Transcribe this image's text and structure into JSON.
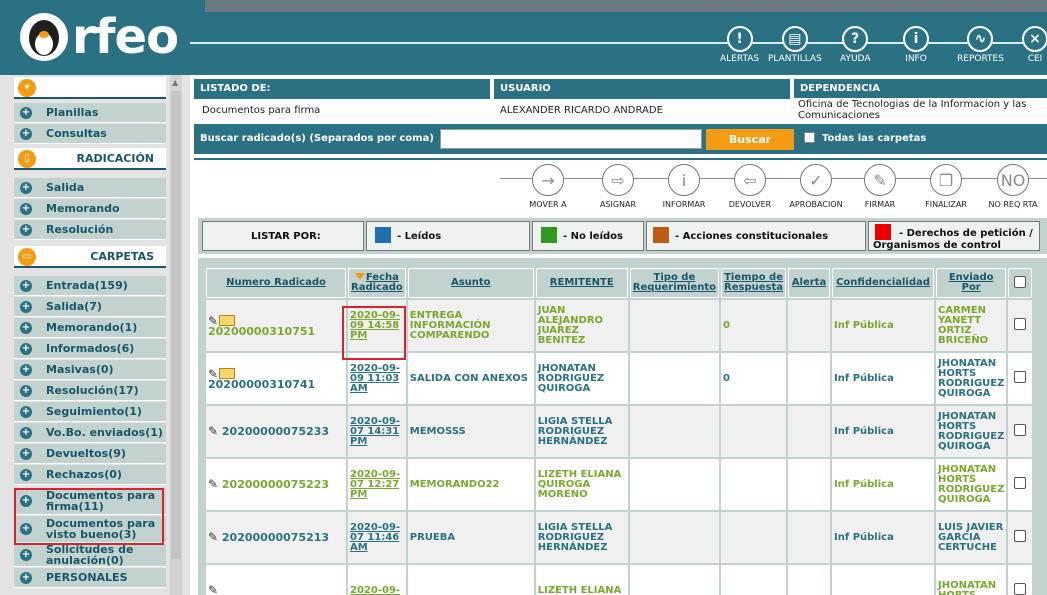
{
  "app": {
    "logo_text": "rfeo",
    "nav": [
      {
        "label": "ALERTAS",
        "icon": "alert-icon",
        "glyph": "!"
      },
      {
        "label": "PLANTILLAS",
        "icon": "template-icon",
        "glyph": "▤"
      },
      {
        "label": "AYUDA",
        "icon": "help-icon",
        "glyph": "?"
      },
      {
        "label": "INFO",
        "icon": "info-icon",
        "glyph": "i"
      },
      {
        "label": "REPORTES",
        "icon": "reports-icon",
        "glyph": "∿"
      },
      {
        "label": "CEI",
        "icon": "close-session-icon",
        "glyph": "×"
      }
    ]
  },
  "sidebar": {
    "top_items": [
      "Planillas",
      "Consultas"
    ],
    "radicacion_title": "RADICACIÓN",
    "radicacion_items": [
      "Salida",
      "Memorando",
      "Resolución"
    ],
    "carpetas_title": "CARPETAS",
    "carpetas_items": [
      "Entrada(159)",
      "Salida(7)",
      "Memorando(1)",
      "Informados(6)",
      "Masivas(0)",
      "Resolución(17)",
      "Seguimiento(1)",
      "Vo.Bo. enviados(1)",
      "Devueltos(9)",
      "Rechazos(0)",
      "Documentos para firma(11)",
      "Documentos para visto bueno(3)",
      "Solicitudes de anulación(0)",
      "PERSONALES"
    ]
  },
  "header": {
    "listado_label": "LISTADO DE:",
    "listado_value": "Documentos para firma",
    "usuario_label": "USUARIO",
    "usuario_value": "ALEXANDER RICARDO ANDRADE",
    "dependencia_label": "DEPENDENCIA",
    "dependencia_value": "Oficina de Tecnologias de la Informacion y las Comunicaciones"
  },
  "search": {
    "label": "Buscar radicado(s) (Separados por coma)",
    "value": "",
    "button": "Buscar",
    "all_folders_label": "Todas las carpetas"
  },
  "toolbar": [
    {
      "label": "MOVER A",
      "icon": "move-icon",
      "glyph": "→"
    },
    {
      "label": "ASIGNAR",
      "icon": "assign-icon",
      "glyph": "⇨"
    },
    {
      "label": "INFORMAR",
      "icon": "inform-icon",
      "glyph": "i"
    },
    {
      "label": "DEVOLVER",
      "icon": "return-icon",
      "glyph": "⇦"
    },
    {
      "label": "APROBACION",
      "icon": "approve-icon",
      "glyph": "✓"
    },
    {
      "label": "FIRMAR",
      "icon": "sign-icon",
      "glyph": "✎"
    },
    {
      "label": "FINALIZAR",
      "icon": "finish-icon",
      "glyph": "❐"
    },
    {
      "label": "NO REQ RTA",
      "icon": "no-response-icon",
      "glyph": "NO"
    }
  ],
  "legend": {
    "title": "LISTAR POR:",
    "items": [
      {
        "label": "- Leídos",
        "color": "#1d6fb0"
      },
      {
        "label": "- No leídos",
        "color": "#2e9a1f"
      },
      {
        "label": "- Acciones constitucionales",
        "color": "#c05c12"
      },
      {
        "label": "- Derechos de petición / Organismos de control",
        "color": "#ee0000"
      }
    ]
  },
  "table": {
    "columns": [
      "Numero Radicado",
      "Fecha Radicado",
      "Asunto",
      "REMITENTE",
      "Tipo de Requerimiento",
      "Tiempo de Respuesta",
      "Alerta",
      "Confidencialidad",
      "Enviado Por"
    ],
    "rows": [
      {
        "numero": "20200000310751",
        "fecha": "2020-09-09 14:58 PM",
        "asunto": "ENTREGA INFORMACIÓN COMPARENDO",
        "remitente": "JUAN ALEJANDRO JUAREZ BENITEZ",
        "tipo": "",
        "tiempo": "0",
        "alerta": "",
        "conf": "Inf Pública",
        "enviado": "CARMEN YANETT ORTIZ BRICEÑO"
      },
      {
        "numero": "20200000310741",
        "fecha": "2020-09-09 11:03 AM",
        "asunto": "SALIDA CON ANEXOS",
        "remitente": "JHONATAN RODRIGUEZ QUIROGA",
        "tipo": "",
        "tiempo": "0",
        "alerta": "",
        "conf": "Inf Pública",
        "enviado": "JHONATAN HORTS RODRIGUEZ QUIROGA"
      },
      {
        "numero": "20200000075233",
        "fecha": "2020-09-07 14:31 PM",
        "asunto": "MEMOSSS",
        "remitente": "LIGIA STELLA RODRIGUEZ HERNÁNDEZ",
        "tipo": "",
        "tiempo": "",
        "alerta": "",
        "conf": "Inf Pública",
        "enviado": "JHONATAN HORTS RODRIGUEZ QUIROGA"
      },
      {
        "numero": "20200000075223",
        "fecha": "2020-09-07 12:27 PM",
        "asunto": "MEMORANDO22",
        "remitente": "LIZETH ELIANA QUIROGA MORENO",
        "tipo": "",
        "tiempo": "",
        "alerta": "",
        "conf": "Inf Pública",
        "enviado": "JHONATAN HORTS RODRIGUEZ QUIROGA"
      },
      {
        "numero": "20200000075213",
        "fecha": "2020-09-07 11:46 AM",
        "asunto": "PRUEBA",
        "remitente": "LIGIA STELLA RODRIGUEZ HERNÁNDEZ",
        "tipo": "",
        "tiempo": "",
        "alerta": "",
        "conf": "Inf Pública",
        "enviado": "LUIS JAVIER GARCIA CERTUCHE"
      },
      {
        "numero": "",
        "fecha": "2020-09-",
        "asunto": "",
        "remitente": "LIZETH ELIANA",
        "tipo": "",
        "tiempo": "",
        "alerta": "",
        "conf": "",
        "enviado": "JHONATAN HORTS"
      }
    ]
  }
}
